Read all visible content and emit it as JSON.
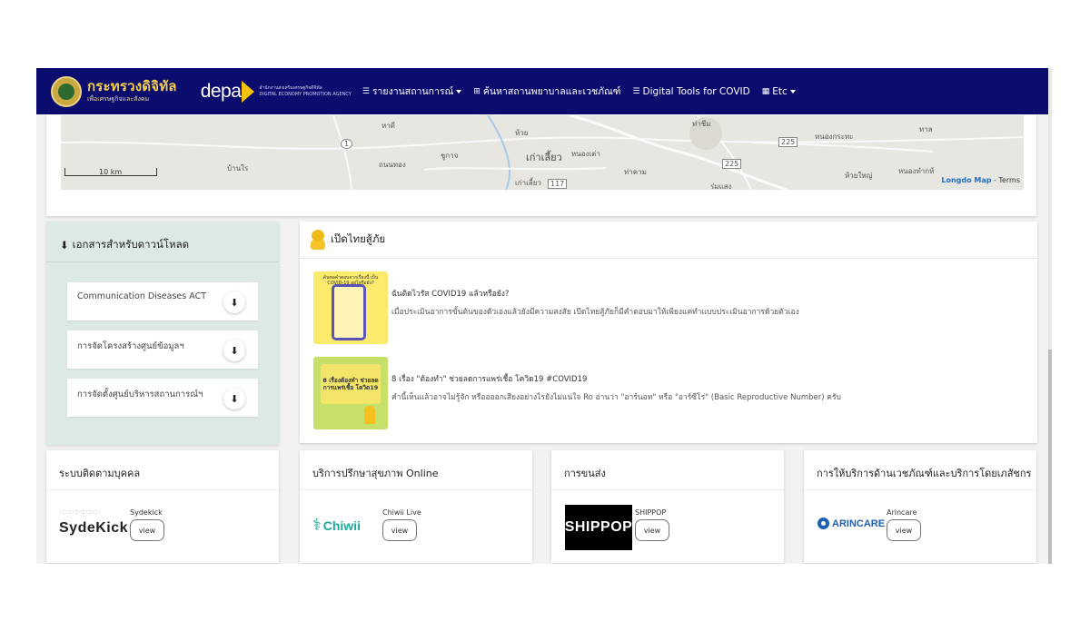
{
  "nav": {
    "ministry_title": "กระทรวงดิจิทัล",
    "ministry_subtitle": "เพื่อเศรษฐกิจและสังคม",
    "depa_word": "depa",
    "depa_subline1": "สำนักงานส่งเสริมเศรษฐกิจดิจิทัล",
    "depa_subline2": "DIGITAL ECONOMY PROMOTION AGENCY",
    "links": [
      {
        "label": "รายงานสถานการณ์",
        "icon": "list-icon",
        "dropdown": true
      },
      {
        "label": "ค้นหาสถานพยาบาลและเวชภัณฑ์",
        "icon": "plus-square-icon",
        "dropdown": false
      },
      {
        "label": "Digital Tools for COVID",
        "icon": "list-icon",
        "dropdown": false
      },
      {
        "label": "Etc",
        "icon": "grid-icon",
        "dropdown": true
      }
    ]
  },
  "map": {
    "labels": [
      "หาดี",
      "ห้วย",
      "ท่าชีม",
      "หนองกระทะ",
      "ทาล",
      "บ้านใร",
      "ถนนทอง",
      "ชูกาจ",
      "เก่าเลี้ยว",
      "หนองเต่า",
      "ห้วยใหญ่",
      "หนองทำกห้",
      "ร่มแสง",
      "เก่าเลี้ยว",
      "ท่าคาม"
    ],
    "road_markers": [
      "1",
      "225",
      "225",
      "117"
    ],
    "scale": "10 km",
    "attribution_brand": "Longdo Map",
    "attribution_terms": "- Terms"
  },
  "docs": {
    "header": "เอกสารสำหรับดาวน์โหลด",
    "items": [
      {
        "label": "Communication Diseases ACT"
      },
      {
        "label": "การจัดโครงสร้างศูนย์ข้อมูลฯ"
      },
      {
        "label": "การจัดตั้งศูนย์บริหารสถานการณ์ฯ"
      }
    ]
  },
  "safe": {
    "header": "เป๊ดไทยสู้ภัย",
    "articles": [
      {
        "title": "ฉันติดไวรัส COVID19 แล้วหรือยัง?",
        "desc": "เมื่อประเมินอาการขั้นต้นของตัวเองแล้วยังมีความสงสัย เป๊ดไทยสู้ภัยก็มีคำตอบมาให้เพียงแค่ทำแบบประเมินอาการด้วยตัวเอง",
        "thumb_text": "ค้นหอคำตอบจากเรื่องนี้ เป็น COVID-19 อยู่ไหรือยัง?"
      },
      {
        "title": "8 เรื่อง \"ต้องทำ\" ช่วยลดการแพร่เชื้อ โควิด19 #COVID19",
        "desc": "คำนี้เห็นแล้วอาจไม่รู้จัก หรืออออกเสียงอย่างไรยังไม่แน่ใจ Ro อ่านว่า \"อาร์นอท\" หรือ \"อาร์ซีโร่\" (Basic Reproductive Number) ครับ",
        "thumb_text": "8 เรื่องต้องทำ ช่วยลดการแพร่เชื้อ โควิด19"
      }
    ]
  },
  "services": [
    {
      "title": "ระบบติดตามบุคคล",
      "name": "Sydekick",
      "logo_text": "SydeKick",
      "view": "view"
    },
    {
      "title": "บริการปรึกษาสุขภาพ Online",
      "name": "Chiwii Live",
      "logo_text": "Chiwii",
      "view": "view"
    },
    {
      "title": "การขนส่ง",
      "name": "SHIPPOP",
      "logo_text": "SHIPPOP",
      "view": "view"
    },
    {
      "title": "การให้บริการด้านเวชภัณฑ์และบริการโดยเภสัชกร",
      "name": "Arincare",
      "logo_text": "ARINCARE",
      "view": "view"
    }
  ],
  "colors": {
    "navbar": "#0b0d6e",
    "ministry_gold": "#f6d04d",
    "depa_yellow": "#f4c20d",
    "docs_bg": "#dde9e7",
    "chiwii_teal": "#1aa89a",
    "arincare_blue": "#1f5fb0"
  }
}
